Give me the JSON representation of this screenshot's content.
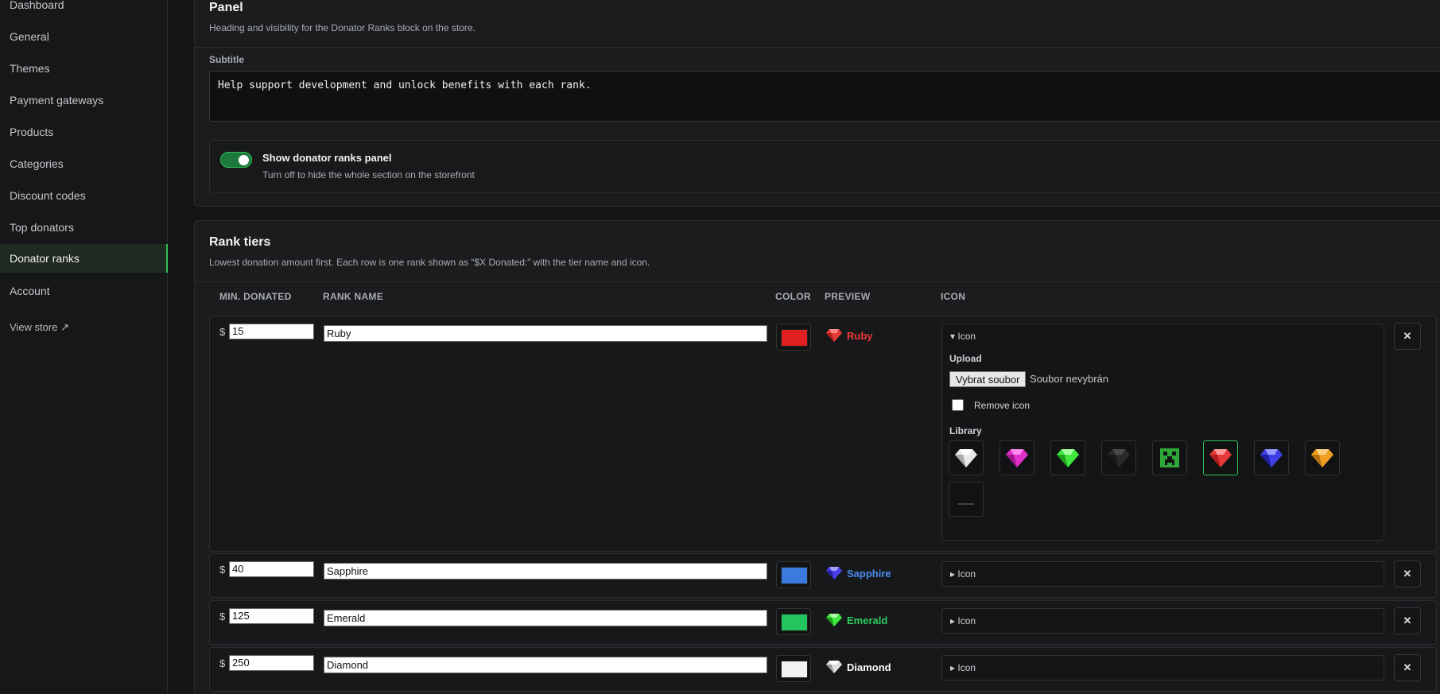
{
  "sidebar": {
    "items": [
      {
        "label": "Dashboard"
      },
      {
        "label": "General"
      },
      {
        "label": "Themes"
      },
      {
        "label": "Payment gateways"
      },
      {
        "label": "Products"
      },
      {
        "label": "Categories"
      },
      {
        "label": "Discount codes"
      },
      {
        "label": "Top donators"
      },
      {
        "label": "Donator ranks"
      },
      {
        "label": "Account"
      }
    ],
    "active": "Donator ranks",
    "view_store": "View store ↗"
  },
  "panel": {
    "title": "Panel",
    "description": "Heading and visibility for the Donator Ranks block on the store.",
    "subtitle_label": "Subtitle",
    "subtitle_value": "Help support development and unlock benefits with each rank.",
    "toggle_title": "Show donator ranks panel",
    "toggle_desc": "Turn off to hide the whole section on the storefront",
    "toggle_on": true
  },
  "tiers": {
    "title": "Rank tiers",
    "description": "Lowest donation amount first. Each row is one rank shown as “$X Donated:” with the tier name and icon.",
    "columns": {
      "min": "MIN. DONATED",
      "name": "RANK NAME",
      "color": "COLOR",
      "preview": "PREVIEW",
      "icon": "ICON"
    },
    "rows": [
      {
        "currency": "$",
        "amount": "15",
        "name": "Ruby",
        "color": "#e02020",
        "preview_color": "#f03a3a",
        "gem": "ruby",
        "icon_label": "Icon",
        "expanded": true
      },
      {
        "currency": "$",
        "amount": "40",
        "name": "Sapphire",
        "color": "#3b7be0",
        "preview_color": "#4c8df0",
        "gem": "sapphire",
        "icon_label": "Icon",
        "expanded": false
      },
      {
        "currency": "$",
        "amount": "125",
        "name": "Emerald",
        "color": "#22c55e",
        "preview_color": "#2ecc5e",
        "gem": "emerald",
        "icon_label": "Icon",
        "expanded": false
      },
      {
        "currency": "$",
        "amount": "250",
        "name": "Diamond",
        "color": "#f2f2f2",
        "preview_color": "#ffffff",
        "gem": "diamond",
        "icon_label": "Icon",
        "expanded": false
      }
    ],
    "icon_panel": {
      "summary": "Icon",
      "upload_label": "Upload",
      "file_button": "Vybrat soubor",
      "file_status": "Soubor nevybrán",
      "remove_label": "Remove icon",
      "library_label": "Library",
      "library": [
        "diamond-white",
        "amethyst-pink",
        "emerald-green",
        "onyx-black",
        "creeper-block",
        "ruby-red",
        "sapphire-blue",
        "topaz-orange",
        "none"
      ],
      "selected": "ruby-red"
    },
    "remove_symbol": "✕"
  }
}
